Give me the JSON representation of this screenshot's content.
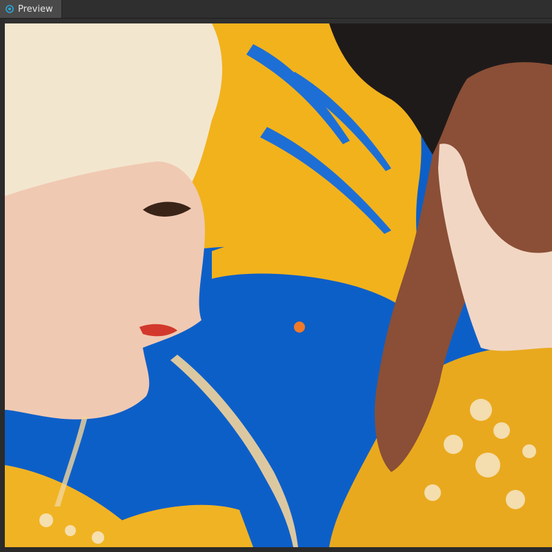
{
  "panel": {
    "tab_label": "Preview",
    "tab_icon": "eye-icon",
    "accent": "#2aa8d8"
  },
  "image": {
    "colors": {
      "blue": "#0d5fc8",
      "yellow": "#f2b21c",
      "skin_light": "#f0c9b2",
      "hair_light": "#f3e6cf",
      "skin_dark": "#8a4f36",
      "hair_dark": "#1f1a1a",
      "garment_yellow": "#e9a91e"
    }
  }
}
